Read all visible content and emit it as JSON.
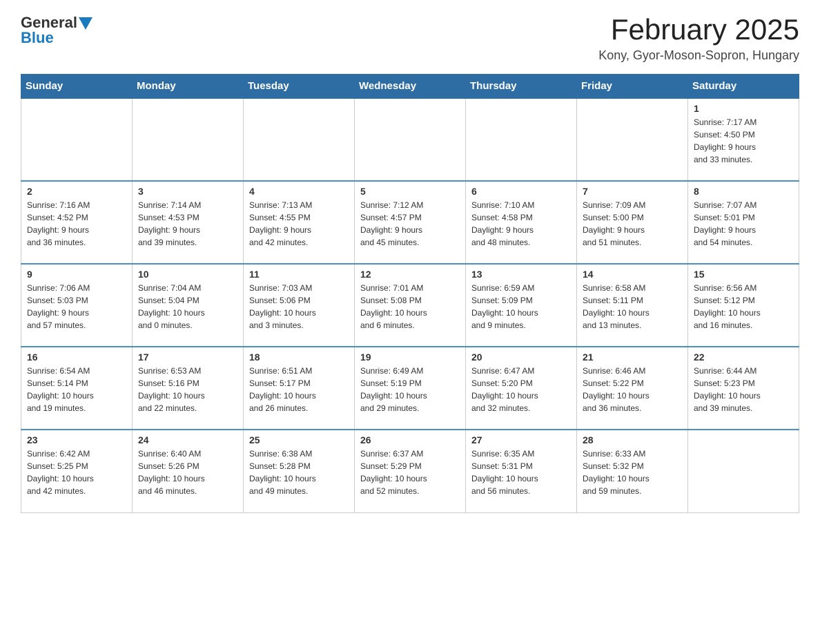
{
  "header": {
    "logo_general": "General",
    "logo_blue": "Blue",
    "month_year": "February 2025",
    "location": "Kony, Gyor-Moson-Sopron, Hungary"
  },
  "weekdays": [
    "Sunday",
    "Monday",
    "Tuesday",
    "Wednesday",
    "Thursday",
    "Friday",
    "Saturday"
  ],
  "weeks": [
    [
      {
        "day": "",
        "info": ""
      },
      {
        "day": "",
        "info": ""
      },
      {
        "day": "",
        "info": ""
      },
      {
        "day": "",
        "info": ""
      },
      {
        "day": "",
        "info": ""
      },
      {
        "day": "",
        "info": ""
      },
      {
        "day": "1",
        "info": "Sunrise: 7:17 AM\nSunset: 4:50 PM\nDaylight: 9 hours\nand 33 minutes."
      }
    ],
    [
      {
        "day": "2",
        "info": "Sunrise: 7:16 AM\nSunset: 4:52 PM\nDaylight: 9 hours\nand 36 minutes."
      },
      {
        "day": "3",
        "info": "Sunrise: 7:14 AM\nSunset: 4:53 PM\nDaylight: 9 hours\nand 39 minutes."
      },
      {
        "day": "4",
        "info": "Sunrise: 7:13 AM\nSunset: 4:55 PM\nDaylight: 9 hours\nand 42 minutes."
      },
      {
        "day": "5",
        "info": "Sunrise: 7:12 AM\nSunset: 4:57 PM\nDaylight: 9 hours\nand 45 minutes."
      },
      {
        "day": "6",
        "info": "Sunrise: 7:10 AM\nSunset: 4:58 PM\nDaylight: 9 hours\nand 48 minutes."
      },
      {
        "day": "7",
        "info": "Sunrise: 7:09 AM\nSunset: 5:00 PM\nDaylight: 9 hours\nand 51 minutes."
      },
      {
        "day": "8",
        "info": "Sunrise: 7:07 AM\nSunset: 5:01 PM\nDaylight: 9 hours\nand 54 minutes."
      }
    ],
    [
      {
        "day": "9",
        "info": "Sunrise: 7:06 AM\nSunset: 5:03 PM\nDaylight: 9 hours\nand 57 minutes."
      },
      {
        "day": "10",
        "info": "Sunrise: 7:04 AM\nSunset: 5:04 PM\nDaylight: 10 hours\nand 0 minutes."
      },
      {
        "day": "11",
        "info": "Sunrise: 7:03 AM\nSunset: 5:06 PM\nDaylight: 10 hours\nand 3 minutes."
      },
      {
        "day": "12",
        "info": "Sunrise: 7:01 AM\nSunset: 5:08 PM\nDaylight: 10 hours\nand 6 minutes."
      },
      {
        "day": "13",
        "info": "Sunrise: 6:59 AM\nSunset: 5:09 PM\nDaylight: 10 hours\nand 9 minutes."
      },
      {
        "day": "14",
        "info": "Sunrise: 6:58 AM\nSunset: 5:11 PM\nDaylight: 10 hours\nand 13 minutes."
      },
      {
        "day": "15",
        "info": "Sunrise: 6:56 AM\nSunset: 5:12 PM\nDaylight: 10 hours\nand 16 minutes."
      }
    ],
    [
      {
        "day": "16",
        "info": "Sunrise: 6:54 AM\nSunset: 5:14 PM\nDaylight: 10 hours\nand 19 minutes."
      },
      {
        "day": "17",
        "info": "Sunrise: 6:53 AM\nSunset: 5:16 PM\nDaylight: 10 hours\nand 22 minutes."
      },
      {
        "day": "18",
        "info": "Sunrise: 6:51 AM\nSunset: 5:17 PM\nDaylight: 10 hours\nand 26 minutes."
      },
      {
        "day": "19",
        "info": "Sunrise: 6:49 AM\nSunset: 5:19 PM\nDaylight: 10 hours\nand 29 minutes."
      },
      {
        "day": "20",
        "info": "Sunrise: 6:47 AM\nSunset: 5:20 PM\nDaylight: 10 hours\nand 32 minutes."
      },
      {
        "day": "21",
        "info": "Sunrise: 6:46 AM\nSunset: 5:22 PM\nDaylight: 10 hours\nand 36 minutes."
      },
      {
        "day": "22",
        "info": "Sunrise: 6:44 AM\nSunset: 5:23 PM\nDaylight: 10 hours\nand 39 minutes."
      }
    ],
    [
      {
        "day": "23",
        "info": "Sunrise: 6:42 AM\nSunset: 5:25 PM\nDaylight: 10 hours\nand 42 minutes."
      },
      {
        "day": "24",
        "info": "Sunrise: 6:40 AM\nSunset: 5:26 PM\nDaylight: 10 hours\nand 46 minutes."
      },
      {
        "day": "25",
        "info": "Sunrise: 6:38 AM\nSunset: 5:28 PM\nDaylight: 10 hours\nand 49 minutes."
      },
      {
        "day": "26",
        "info": "Sunrise: 6:37 AM\nSunset: 5:29 PM\nDaylight: 10 hours\nand 52 minutes."
      },
      {
        "day": "27",
        "info": "Sunrise: 6:35 AM\nSunset: 5:31 PM\nDaylight: 10 hours\nand 56 minutes."
      },
      {
        "day": "28",
        "info": "Sunrise: 6:33 AM\nSunset: 5:32 PM\nDaylight: 10 hours\nand 59 minutes."
      },
      {
        "day": "",
        "info": ""
      }
    ]
  ]
}
